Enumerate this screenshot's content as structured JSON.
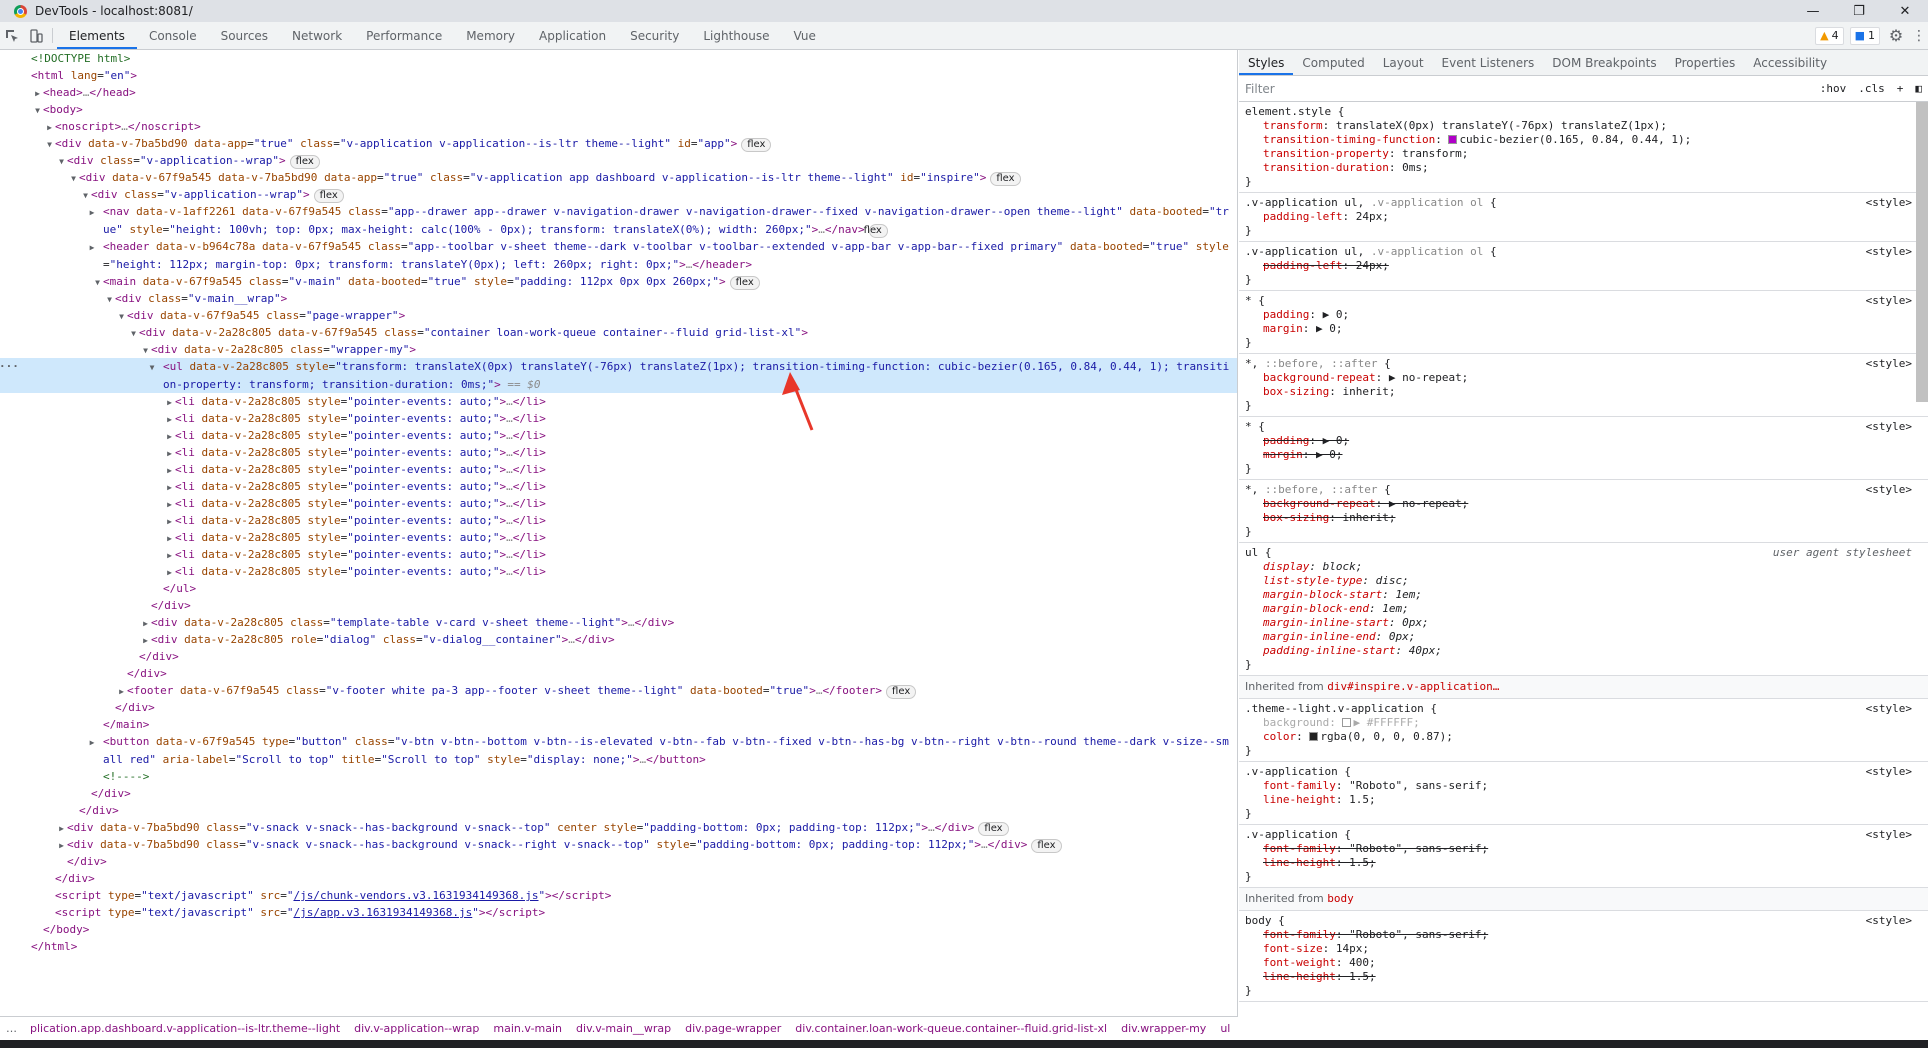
{
  "window": {
    "title": "DevTools - localhost:8081/",
    "controls": [
      "—",
      "❐",
      "✕"
    ]
  },
  "toolbar": {
    "tabs": [
      "Elements",
      "Console",
      "Sources",
      "Network",
      "Performance",
      "Memory",
      "Application",
      "Security",
      "Lighthouse",
      "Vue"
    ],
    "warnings_count": "4",
    "messages_count": "1"
  },
  "dom_tree": [
    {
      "indent": 0,
      "tri": "",
      "html": "<span class='cm'>&lt;!DOCTYPE html&gt;</span>"
    },
    {
      "indent": 0,
      "tri": "",
      "html": "<span class='tg'>&lt;html</span> <span class='an'>lang</span>=<span class='av'>\"en\"</span><span class='tg'>&gt;</span>"
    },
    {
      "indent": 1,
      "tri": "▶",
      "html": "<span class='tg'>&lt;head&gt;</span><span class='dt'>…</span><span class='tg'>&lt;/head&gt;</span>"
    },
    {
      "indent": 1,
      "tri": "▼",
      "html": "<span class='tg'>&lt;body&gt;</span>"
    },
    {
      "indent": 2,
      "tri": "▶",
      "html": "<span class='tg'>&lt;noscript&gt;</span><span class='dt'>…</span><span class='tg'>&lt;/noscript&gt;</span>"
    },
    {
      "indent": 2,
      "tri": "▼",
      "html": "<span class='tg'>&lt;div</span> <span class='an'>data-v-7ba5bd90</span> <span class='an'>data-app</span>=<span class='av'>\"true\"</span> <span class='an'>class</span>=<span class='av'>\"v-application v-application--is-ltr theme--light\"</span> <span class='an'>id</span>=<span class='av'>\"app\"</span><span class='tg'>&gt;</span>",
      "pill": "flex"
    },
    {
      "indent": 3,
      "tri": "▼",
      "html": "<span class='tg'>&lt;div</span> <span class='an'>class</span>=<span class='av'>\"v-application--wrap\"</span><span class='tg'>&gt;</span>",
      "pill": "flex"
    },
    {
      "indent": 4,
      "tri": "▼",
      "html": "<span class='tg'>&lt;div</span> <span class='an'>data-v-67f9a545</span> <span class='an'>data-v-7ba5bd90</span> <span class='an'>data-app</span>=<span class='av'>\"true\"</span> <span class='an'>class</span>=<span class='av'>\"v-application app dashboard v-application--is-ltr theme--light\"</span> <span class='an'>id</span>=<span class='av'>\"inspire\"</span><span class='tg'>&gt;</span>",
      "pill": "flex"
    },
    {
      "indent": 5,
      "tri": "▼",
      "html": "<span class='tg'>&lt;div</span> <span class='an'>class</span>=<span class='av'>\"v-application--wrap\"</span><span class='tg'>&gt;</span>",
      "pill": "flex"
    },
    {
      "indent": 6,
      "tri": "▶",
      "wrap": true,
      "html": "<span class='tg'>&lt;nav</span> <span class='an'>data-v-1aff2261</span> <span class='an'>data-v-67f9a545</span> <span class='an'>class</span>=<span class='av'>\"app--drawer app--drawer v-navigation-drawer v-navigation-drawer--fixed v-navigation-drawer--open theme--light\"</span> <span class='an'>data-booted</span>=<span class='av'>\"true\"</span> <span class='an'>style</span>=<span class='av'>\"height: 100vh; top: 0px; max-height: calc(100% - 0px); transform: translateX(0%); width: 260px;\"</span><span class='tg'>&gt;</span><span class='dt'>…</span><span class='tg'>&lt;/nav&gt;</span>",
      "pill": "flex"
    },
    {
      "indent": 6,
      "tri": "▶",
      "wrap": true,
      "html": "<span class='tg'>&lt;header</span> <span class='an'>data-v-b964c78a</span> <span class='an'>data-v-67f9a545</span> <span class='an'>class</span>=<span class='av'>\"app--toolbar v-sheet theme--dark v-toolbar v-toolbar--extended v-app-bar v-app-bar--fixed primary\"</span> <span class='an'>data-booted</span>=<span class='av'>\"true\"</span> <span class='an'>style</span>=<span class='av'>\"height: 112px; margin-top: 0px; transform: translateY(0px); left: 260px; right: 0px;\"</span><span class='tg'>&gt;</span><span class='dt'>…</span><span class='tg'>&lt;/header&gt;</span>"
    },
    {
      "indent": 6,
      "tri": "▼",
      "html": "<span class='tg'>&lt;main</span> <span class='an'>data-v-67f9a545</span> <span class='an'>class</span>=<span class='av'>\"v-main\"</span> <span class='an'>data-booted</span>=<span class='av'>\"true\"</span> <span class='an'>style</span>=<span class='av'>\"padding: 112px 0px 0px 260px;\"</span><span class='tg'>&gt;</span>",
      "pill": "flex"
    },
    {
      "indent": 7,
      "tri": "▼",
      "html": "<span class='tg'>&lt;div</span> <span class='an'>class</span>=<span class='av'>\"v-main__wrap\"</span><span class='tg'>&gt;</span>"
    },
    {
      "indent": 8,
      "tri": "▼",
      "html": "<span class='tg'>&lt;div</span> <span class='an'>data-v-67f9a545</span> <span class='an'>class</span>=<span class='av'>\"page-wrapper\"</span><span class='tg'>&gt;</span>"
    },
    {
      "indent": 9,
      "tri": "▼",
      "html": "<span class='tg'>&lt;div</span> <span class='an'>data-v-2a28c805</span> <span class='an'>data-v-67f9a545</span> <span class='an'>class</span>=<span class='av'>\"container loan-work-queue container--fluid grid-list-xl\"</span><span class='tg'>&gt;</span>"
    },
    {
      "indent": 10,
      "tri": "▼",
      "html": "<span class='tg'>&lt;div</span> <span class='an'>data-v-2a28c805</span> <span class='an'>class</span>=<span class='av'>\"wrapper-my\"</span><span class='tg'>&gt;</span>"
    },
    {
      "indent": 11,
      "tri": "▼",
      "wrap": true,
      "selected": true,
      "html": "<span class='tg'>&lt;ul</span> <span class='an'>data-v-2a28c805</span> <span class='an'>style</span>=<span class='av'>\"transform: translateX(0px) translateY(-76px) translateZ(1px); transition-timing-function: cubic-bezier(0.165, 0.84, 0.44, 1); transition-property: transform; transition-duration: 0ms;\"</span><span class='tg'>&gt;</span> <span class='eq'>== $0</span>"
    },
    {
      "indent": 12,
      "tri": "▶",
      "html": "<span class='tg'>&lt;li</span> <span class='an'>data-v-2a28c805</span> <span class='an'>style</span>=<span class='av'>\"pointer-events: auto;\"</span><span class='tg'>&gt;</span><span class='dt'>…</span><span class='tg'>&lt;/li&gt;</span>"
    },
    {
      "indent": 12,
      "tri": "▶",
      "html": "<span class='tg'>&lt;li</span> <span class='an'>data-v-2a28c805</span> <span class='an'>style</span>=<span class='av'>\"pointer-events: auto;\"</span><span class='tg'>&gt;</span><span class='dt'>…</span><span class='tg'>&lt;/li&gt;</span>"
    },
    {
      "indent": 12,
      "tri": "▶",
      "html": "<span class='tg'>&lt;li</span> <span class='an'>data-v-2a28c805</span> <span class='an'>style</span>=<span class='av'>\"pointer-events: auto;\"</span><span class='tg'>&gt;</span><span class='dt'>…</span><span class='tg'>&lt;/li&gt;</span>"
    },
    {
      "indent": 12,
      "tri": "▶",
      "html": "<span class='tg'>&lt;li</span> <span class='an'>data-v-2a28c805</span> <span class='an'>style</span>=<span class='av'>\"pointer-events: auto;\"</span><span class='tg'>&gt;</span><span class='dt'>…</span><span class='tg'>&lt;/li&gt;</span>"
    },
    {
      "indent": 12,
      "tri": "▶",
      "html": "<span class='tg'>&lt;li</span> <span class='an'>data-v-2a28c805</span> <span class='an'>style</span>=<span class='av'>\"pointer-events: auto;\"</span><span class='tg'>&gt;</span><span class='dt'>…</span><span class='tg'>&lt;/li&gt;</span>"
    },
    {
      "indent": 12,
      "tri": "▶",
      "html": "<span class='tg'>&lt;li</span> <span class='an'>data-v-2a28c805</span> <span class='an'>style</span>=<span class='av'>\"pointer-events: auto;\"</span><span class='tg'>&gt;</span><span class='dt'>…</span><span class='tg'>&lt;/li&gt;</span>"
    },
    {
      "indent": 12,
      "tri": "▶",
      "html": "<span class='tg'>&lt;li</span> <span class='an'>data-v-2a28c805</span> <span class='an'>style</span>=<span class='av'>\"pointer-events: auto;\"</span><span class='tg'>&gt;</span><span class='dt'>…</span><span class='tg'>&lt;/li&gt;</span>"
    },
    {
      "indent": 12,
      "tri": "▶",
      "html": "<span class='tg'>&lt;li</span> <span class='an'>data-v-2a28c805</span> <span class='an'>style</span>=<span class='av'>\"pointer-events: auto;\"</span><span class='tg'>&gt;</span><span class='dt'>…</span><span class='tg'>&lt;/li&gt;</span>"
    },
    {
      "indent": 12,
      "tri": "▶",
      "html": "<span class='tg'>&lt;li</span> <span class='an'>data-v-2a28c805</span> <span class='an'>style</span>=<span class='av'>\"pointer-events: auto;\"</span><span class='tg'>&gt;</span><span class='dt'>…</span><span class='tg'>&lt;/li&gt;</span>"
    },
    {
      "indent": 12,
      "tri": "▶",
      "html": "<span class='tg'>&lt;li</span> <span class='an'>data-v-2a28c805</span> <span class='an'>style</span>=<span class='av'>\"pointer-events: auto;\"</span><span class='tg'>&gt;</span><span class='dt'>…</span><span class='tg'>&lt;/li&gt;</span>"
    },
    {
      "indent": 12,
      "tri": "▶",
      "html": "<span class='tg'>&lt;li</span> <span class='an'>data-v-2a28c805</span> <span class='an'>style</span>=<span class='av'>\"pointer-events: auto;\"</span><span class='tg'>&gt;</span><span class='dt'>…</span><span class='tg'>&lt;/li&gt;</span>"
    },
    {
      "indent": 11,
      "tri": "",
      "html": "<span class='tg'>&lt;/ul&gt;</span>"
    },
    {
      "indent": 10,
      "tri": "",
      "html": "<span class='tg'>&lt;/div&gt;</span>"
    },
    {
      "indent": 10,
      "tri": "▶",
      "html": "<span class='tg'>&lt;div</span> <span class='an'>data-v-2a28c805</span> <span class='an'>class</span>=<span class='av'>\"template-table v-card v-sheet theme--light\"</span><span class='tg'>&gt;</span><span class='dt'>…</span><span class='tg'>&lt;/div&gt;</span>"
    },
    {
      "indent": 10,
      "tri": "▶",
      "html": "<span class='tg'>&lt;div</span> <span class='an'>data-v-2a28c805</span> <span class='an'>role</span>=<span class='av'>\"dialog\"</span> <span class='an'>class</span>=<span class='av'>\"v-dialog__container\"</span><span class='tg'>&gt;</span><span class='dt'>…</span><span class='tg'>&lt;/div&gt;</span>"
    },
    {
      "indent": 9,
      "tri": "",
      "html": "<span class='tg'>&lt;/div&gt;</span>"
    },
    {
      "indent": 8,
      "tri": "",
      "html": "<span class='tg'>&lt;/div&gt;</span>"
    },
    {
      "indent": 8,
      "tri": "▶",
      "html": "<span class='tg'>&lt;footer</span> <span class='an'>data-v-67f9a545</span> <span class='an'>class</span>=<span class='av'>\"v-footer white pa-3 app--footer v-sheet theme--light\"</span> <span class='an'>data-booted</span>=<span class='av'>\"true\"</span><span class='tg'>&gt;</span><span class='dt'>…</span><span class='tg'>&lt;/footer&gt;</span>",
      "pill": "flex"
    },
    {
      "indent": 7,
      "tri": "",
      "html": "<span class='tg'>&lt;/div&gt;</span>"
    },
    {
      "indent": 6,
      "tri": "",
      "html": "<span class='tg'>&lt;/main&gt;</span>"
    },
    {
      "indent": 6,
      "tri": "▶",
      "wrap": true,
      "html": "<span class='tg'>&lt;button</span> <span class='an'>data-v-67f9a545</span> <span class='an'>type</span>=<span class='av'>\"button\"</span> <span class='an'>class</span>=<span class='av'>\"v-btn v-btn--bottom v-btn--is-elevated v-btn--fab v-btn--fixed v-btn--has-bg v-btn--right v-btn--round theme--dark v-size--small red\"</span> <span class='an'>aria-label</span>=<span class='av'>\"Scroll to top\"</span> <span class='an'>title</span>=<span class='av'>\"Scroll to top\"</span> <span class='an'>style</span>=<span class='av'>\"display: none;\"</span><span class='tg'>&gt;</span><span class='dt'>…</span><span class='tg'>&lt;/button&gt;</span>"
    },
    {
      "indent": 6,
      "tri": "",
      "html": "<span class='cm'>&lt;!----&gt;</span>"
    },
    {
      "indent": 5,
      "tri": "",
      "html": "<span class='tg'>&lt;/div&gt;</span>"
    },
    {
      "indent": 4,
      "tri": "",
      "html": "<span class='tg'>&lt;/div&gt;</span>"
    },
    {
      "indent": 3,
      "tri": "▶",
      "html": "<span class='tg'>&lt;div</span> <span class='an'>data-v-7ba5bd90</span> <span class='an'>class</span>=<span class='av'>\"v-snack v-snack--has-background v-snack--top\"</span> <span class='an'>center</span> <span class='an'>style</span>=<span class='av'>\"padding-bottom: 0px; padding-top: 112px;\"</span><span class='tg'>&gt;</span><span class='dt'>…</span><span class='tg'>&lt;/div&gt;</span>",
      "pill": "flex"
    },
    {
      "indent": 3,
      "tri": "▶",
      "html": "<span class='tg'>&lt;div</span> <span class='an'>data-v-7ba5bd90</span> <span class='an'>class</span>=<span class='av'>\"v-snack v-snack--has-background v-snack--right v-snack--top\"</span> <span class='an'>style</span>=<span class='av'>\"padding-bottom: 0px; padding-top: 112px;\"</span><span class='tg'>&gt;</span><span class='dt'>…</span><span class='tg'>&lt;/div&gt;</span>",
      "pill": "flex"
    },
    {
      "indent": 3,
      "tri": "",
      "html": "<span class='tg'>&lt;/div&gt;</span>"
    },
    {
      "indent": 2,
      "tri": "",
      "html": "<span class='tg'>&lt;/div&gt;</span>"
    },
    {
      "indent": 2,
      "tri": "",
      "html": "<span class='tg'>&lt;script</span> <span class='an'>type</span>=<span class='av'>\"text/javascript\"</span> <span class='an'>src</span>=<span class='av'>\"<span class='lk'>/js/chunk-vendors.v3.1631934149368.js</span>\"</span><span class='tg'>&gt;&lt;/script&gt;</span>"
    },
    {
      "indent": 2,
      "tri": "",
      "html": "<span class='tg'>&lt;script</span> <span class='an'>type</span>=<span class='av'>\"text/javascript\"</span> <span class='an'>src</span>=<span class='av'>\"<span class='lk'>/js/app.v3.1631934149368.js</span>\"</span><span class='tg'>&gt;&lt;/script&gt;</span>"
    },
    {
      "indent": 1,
      "tri": "",
      "html": "<span class='tg'>&lt;/body&gt;</span>"
    },
    {
      "indent": 0,
      "tri": "",
      "html": "<span class='tg'>&lt;/html&gt;</span>"
    }
  ],
  "breadcrumbs": {
    "lead": "…",
    "items": [
      "plication.app.dashboard.v-application--is-ltr.theme--light",
      "div.v-application--wrap",
      "main.v-main",
      "div.v-main__wrap",
      "div.page-wrapper",
      "div.container.loan-work-queue.container--fluid.grid-list-xl",
      "div.wrapper-my",
      "ul"
    ],
    "more": "…"
  },
  "styles_panel": {
    "tabs": [
      "Styles",
      "Computed",
      "Layout",
      "Event Listeners",
      "DOM Breakpoints",
      "Properties",
      "Accessibility"
    ],
    "filter_placeholder": "Filter",
    "hov": ":hov",
    "cls": ".cls",
    "add_rule": "+",
    "rules": [
      {
        "selector": "element.style {",
        "source": "",
        "decls": [
          {
            "p": "transform",
            "v": "translateX(0px) translateY(-76px) translateZ(1px);"
          },
          {
            "p": "transition-timing-function",
            "v": "cubic-bezier(0.165, 0.84, 0.44, 1);",
            "swatch": "#b000c8"
          },
          {
            "p": "transition-property",
            "v": "transform;"
          },
          {
            "p": "transition-duration",
            "v": "0ms;"
          }
        ]
      },
      {
        "selector": ".v-application ul, .v-application ol {",
        "source": "<style>",
        "decls": [
          {
            "p": "padding-left",
            "v": "24px;"
          }
        ]
      },
      {
        "selector": ".v-application ul, .v-application ol {",
        "source": "<style>",
        "decls": [
          {
            "p": "padding-left",
            "v": "24px;",
            "strike": true
          }
        ]
      },
      {
        "selector": "* {",
        "source": "<style>",
        "decls": [
          {
            "p": "padding",
            "v": "▶ 0;"
          },
          {
            "p": "margin",
            "v": "▶ 0;"
          }
        ]
      },
      {
        "selector": "*, ::before, ::after {",
        "source": "<style>",
        "decls": [
          {
            "p": "background-repeat",
            "v": "▶ no-repeat;"
          },
          {
            "p": "box-sizing",
            "v": "inherit;"
          }
        ]
      },
      {
        "selector": "* {",
        "source": "<style>",
        "decls": [
          {
            "p": "padding",
            "v": "▶ 0;",
            "strike": true
          },
          {
            "p": "margin",
            "v": "▶ 0;",
            "strike": true
          }
        ]
      },
      {
        "selector": "*, ::before, ::after {",
        "source": "<style>",
        "decls": [
          {
            "p": "background-repeat",
            "v": "▶ no-repeat;",
            "strike": true
          },
          {
            "p": "box-sizing",
            "v": "inherit;",
            "strike": true
          }
        ]
      },
      {
        "selector": "ul {",
        "source": "user agent stylesheet",
        "ua": true,
        "decls": [
          {
            "p": "display",
            "v": "block;",
            "it": true
          },
          {
            "p": "list-style-type",
            "v": "disc;",
            "it": true
          },
          {
            "p": "margin-block-start",
            "v": "1em;",
            "it": true
          },
          {
            "p": "margin-block-end",
            "v": "1em;",
            "it": true
          },
          {
            "p": "margin-inline-start",
            "v": "0px;",
            "it": true
          },
          {
            "p": "margin-inline-end",
            "v": "0px;",
            "it": true
          },
          {
            "p": "padding-inline-start",
            "v": "40px;",
            "it": true
          }
        ]
      },
      {
        "inherit": true,
        "label": "Inherited from ",
        "ref": "div#inspire.v-application…"
      },
      {
        "selector": ".theme--light.v-application {",
        "source": "<style>",
        "decls": [
          {
            "p": "background",
            "v": "▶ #FFFFFF;",
            "dim": true,
            "swatch": "#ffffff"
          },
          {
            "p": "color",
            "v": "rgba(0, 0, 0, 0.87);",
            "swatch": "#222222"
          }
        ]
      },
      {
        "selector": ".v-application {",
        "source": "<style>",
        "decls": [
          {
            "p": "font-family",
            "v": "\"Roboto\", sans-serif;"
          },
          {
            "p": "line-height",
            "v": "1.5;"
          }
        ]
      },
      {
        "selector": ".v-application {",
        "source": "<style>",
        "decls": [
          {
            "p": "font-family",
            "v": "\"Roboto\", sans-serif;",
            "strike": true
          },
          {
            "p": "line-height",
            "v": "1.5;",
            "strike": true
          }
        ]
      },
      {
        "inherit": true,
        "label": "Inherited from ",
        "ref": "body"
      },
      {
        "selector": "body {",
        "source": "<style>",
        "decls": [
          {
            "p": "font-family",
            "v": "\"Roboto\", sans-serif;",
            "strike": true
          },
          {
            "p": "font-size",
            "v": "14px;"
          },
          {
            "p": "font-weight",
            "v": "400;"
          },
          {
            "p": "line-height",
            "v": "1.5;",
            "strike": true
          }
        ]
      }
    ]
  },
  "colors": {
    "accent": "#1a73e8",
    "selection": "#cfe8fc",
    "arrow": "#e8372a"
  }
}
